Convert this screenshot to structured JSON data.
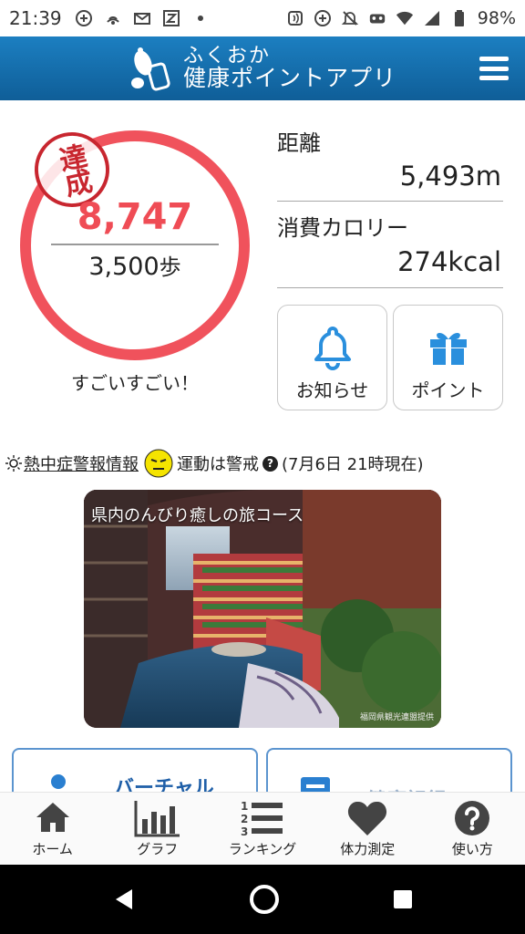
{
  "status_bar": {
    "time": "21:39",
    "battery_pct": "98%",
    "icons_left": [
      "pay-icon",
      "nfc-icon",
      "mail-icon",
      "z-app-icon",
      "dot-icon"
    ],
    "icons_right": [
      "nfc-reader-icon",
      "plus-circle-icon",
      "mute-icon",
      "game-icon",
      "wifi-icon",
      "signal-icon",
      "battery-icon"
    ]
  },
  "header": {
    "title_line1": "ふくおか",
    "title_line2": "健康ポイントアプリ"
  },
  "steps": {
    "stamp": "達成",
    "count": "8,747",
    "goal": "3,500",
    "goal_unit": "歩",
    "message": "すごいすごい！"
  },
  "stats": {
    "distance_label": "距離",
    "distance_value": "5,493m",
    "calorie_label": "消費カロリー",
    "calorie_value": "274kcal"
  },
  "tiles": {
    "notice_label": "お知らせ",
    "point_label": "ポイント"
  },
  "heat_info": {
    "link": "熱中症警報情報",
    "status": "運動は警戒",
    "timestamp": "(7月6日 21時現在)"
  },
  "banner": {
    "title": "県内のんびり癒しの旅コース",
    "credit": "福岡県観光連盟提供"
  },
  "cards": {
    "left_label": "バーチャル",
    "right_label": "健康記録"
  },
  "bottom_nav": [
    {
      "label": "ホーム",
      "icon": "home-icon"
    },
    {
      "label": "グラフ",
      "icon": "graph-icon"
    },
    {
      "label": "ランキング",
      "icon": "ranking-icon"
    },
    {
      "label": "体力測定",
      "icon": "heart-icon"
    },
    {
      "label": "使い方",
      "icon": "help-icon"
    }
  ],
  "colors": {
    "header_blue": "#1470b0",
    "ring_red": "#f0525c",
    "steps_red": "#ef4c55",
    "icon_blue": "#2a8fdd",
    "card_border": "#5b94cf"
  }
}
